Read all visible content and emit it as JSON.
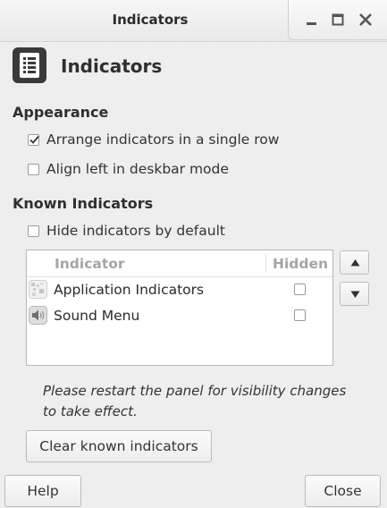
{
  "window": {
    "title": "Indicators"
  },
  "header": {
    "title": "Indicators",
    "icon": "list-document-icon"
  },
  "appearance": {
    "title": "Appearance",
    "single_row": {
      "label": "Arrange indicators in a single row",
      "checked": true
    },
    "align_left": {
      "label": "Align left in deskbar mode",
      "checked": false
    }
  },
  "known": {
    "title": "Known Indicators",
    "hide_default": {
      "label": "Hide indicators by default",
      "checked": false
    },
    "columns": {
      "indicator": "Indicator",
      "hidden": "Hidden"
    },
    "rows": [
      {
        "label": "Application Indicators",
        "icon": "application-indicators-icon",
        "hidden": false
      },
      {
        "label": "Sound Menu",
        "icon": "speaker-icon",
        "hidden": false
      }
    ],
    "move_up_icon": "arrow-up-icon",
    "move_down_icon": "arrow-down-icon",
    "note": "Please restart the panel for visibility changes to take effect.",
    "clear_button": "Clear known indicators"
  },
  "footer": {
    "help": "Help",
    "close": "Close"
  }
}
